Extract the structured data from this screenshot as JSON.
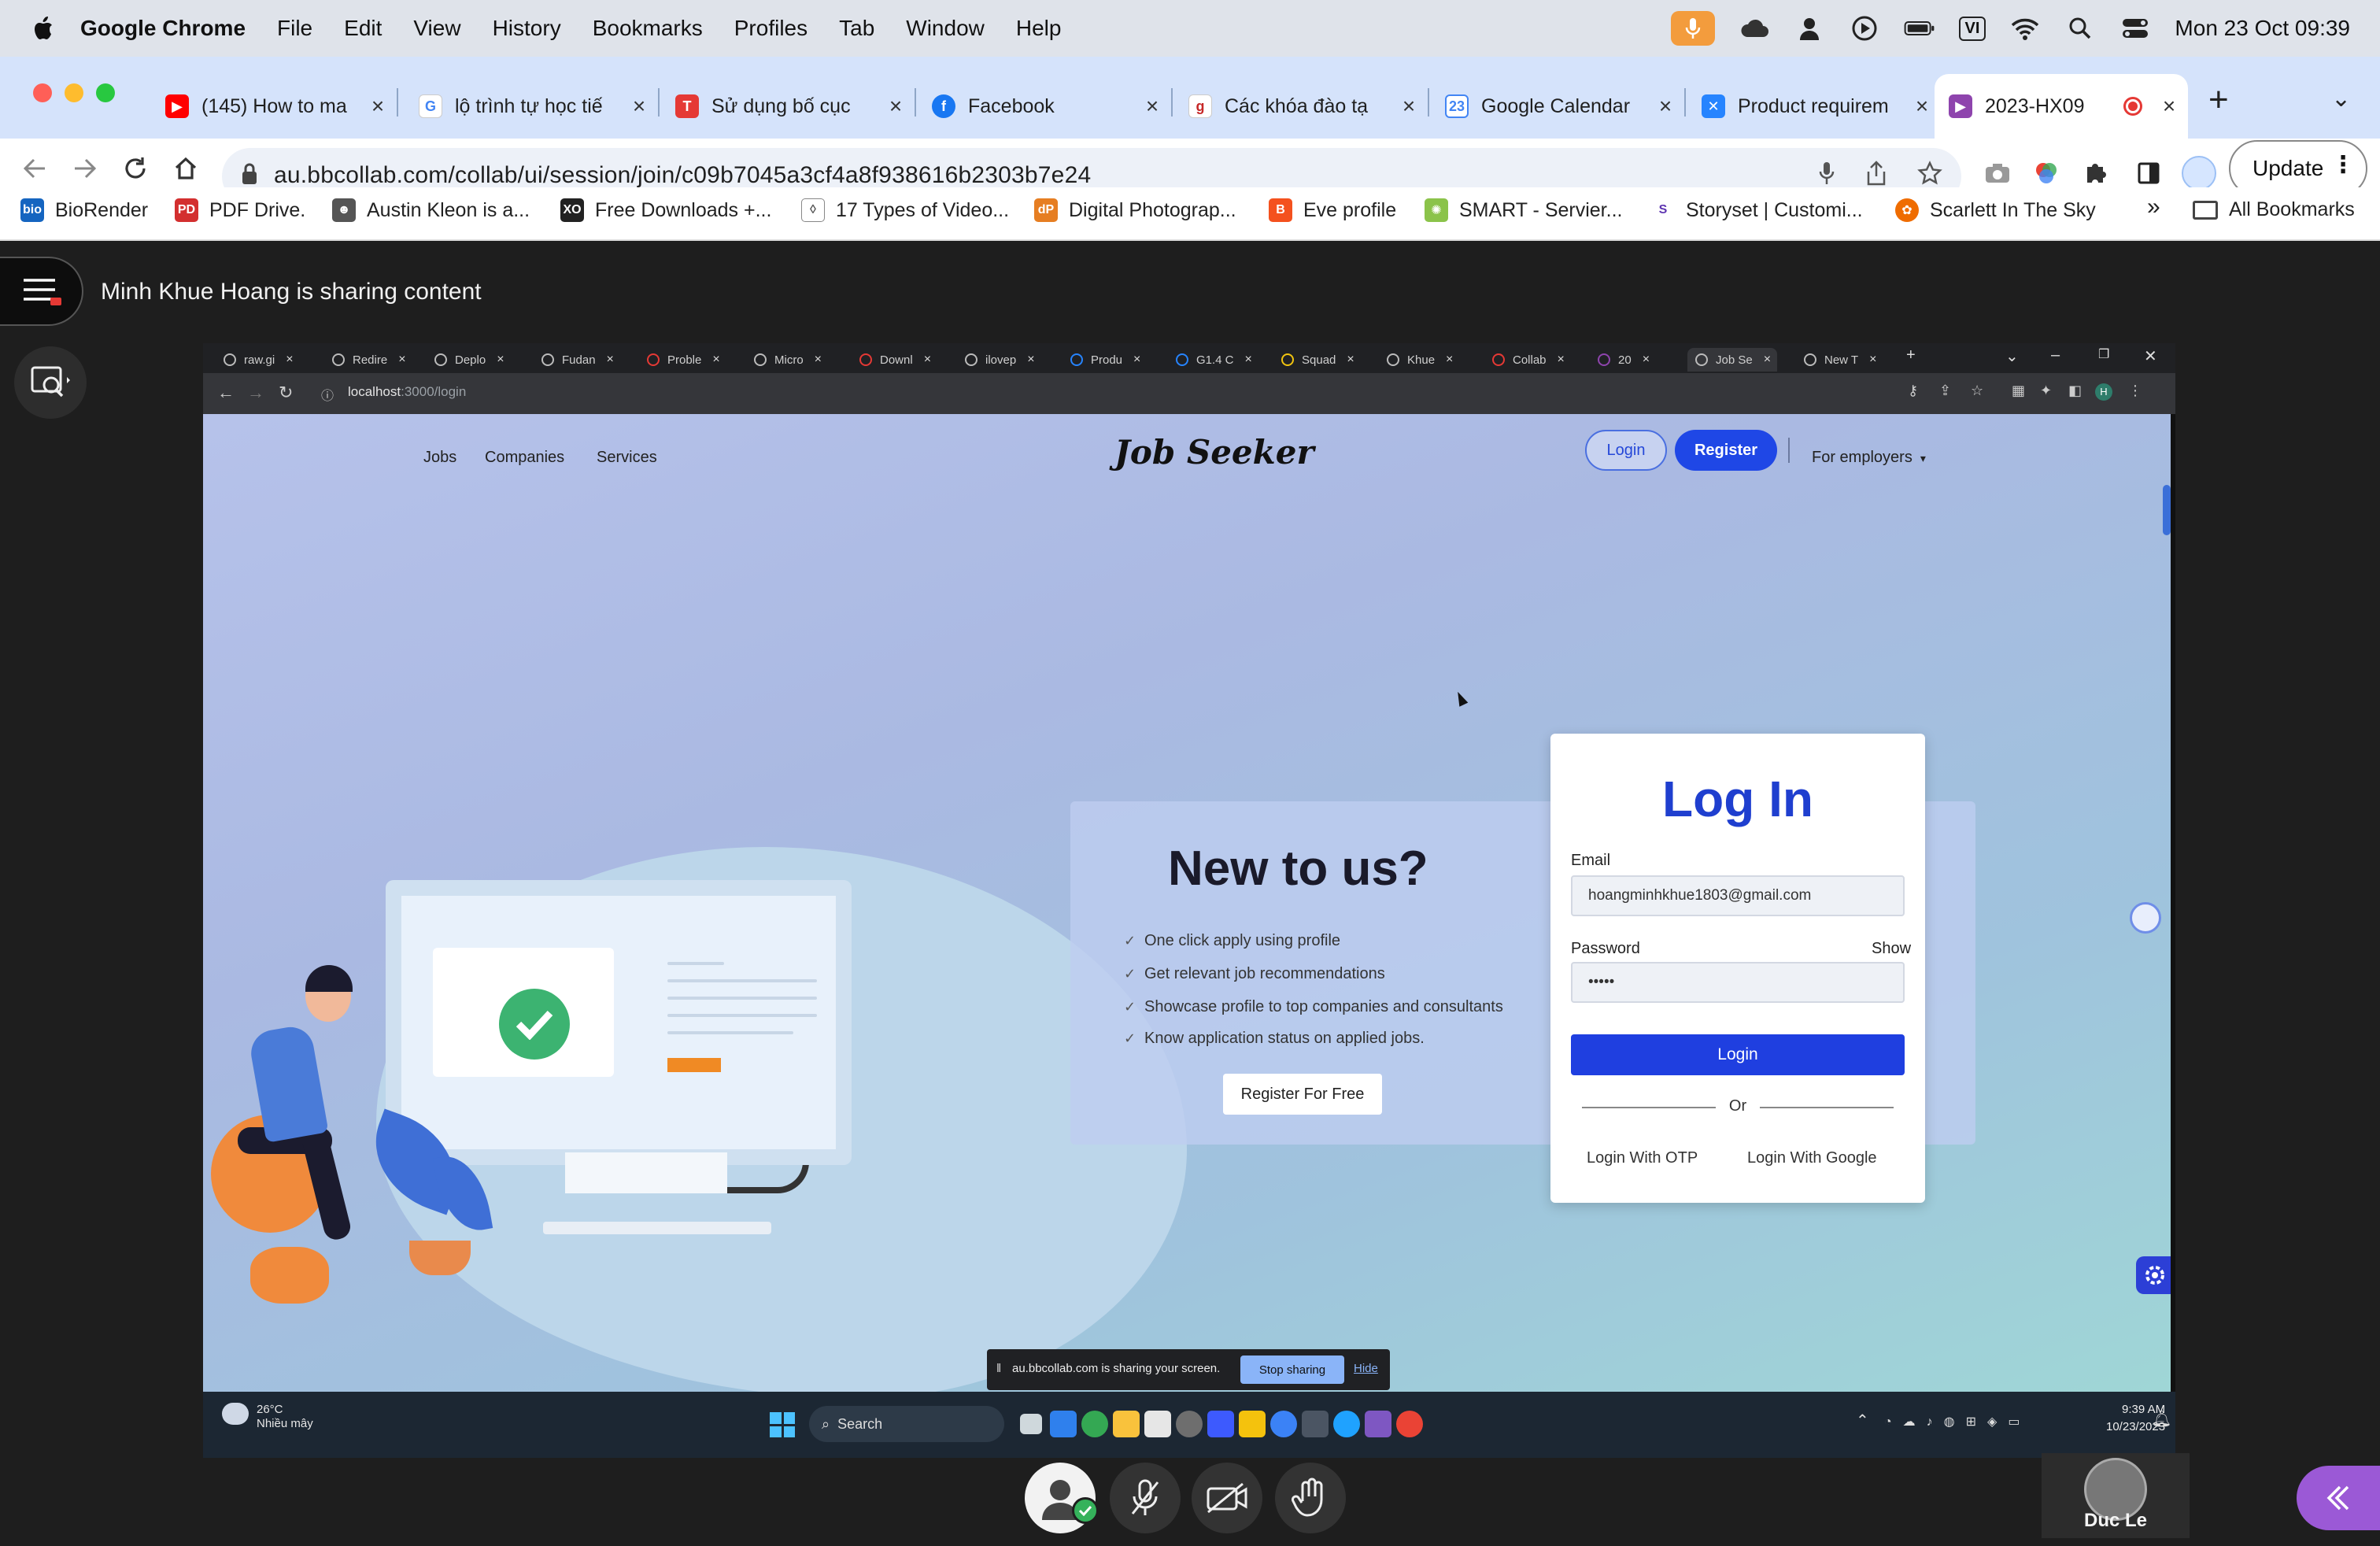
{
  "menubar": {
    "app_name": "Google Chrome",
    "items": [
      "File",
      "Edit",
      "View",
      "History",
      "Bookmarks",
      "Profiles",
      "Tab",
      "Window",
      "Help"
    ],
    "input_source": "VI",
    "datetime": "Mon 23 Oct  09:39"
  },
  "tabs": [
    {
      "label": "(145) How to ma",
      "icon": "youtube-icon",
      "color": "#ff0000"
    },
    {
      "label": "lộ trình tự học tiế",
      "icon": "google-icon",
      "color": "#4285f4"
    },
    {
      "label": "Sử dụng bố cục",
      "icon": "t-icon",
      "color": "#e53935"
    },
    {
      "label": "Facebook",
      "icon": "facebook-icon",
      "color": "#1877f2"
    },
    {
      "label": "Các khóa đào tạ",
      "icon": "course-icon",
      "color": "#c62828"
    },
    {
      "label": "Google Calendar",
      "icon": "calendar-icon",
      "color": "#4285f4"
    },
    {
      "label": "Product requirem",
      "icon": "jira-icon",
      "color": "#2684ff"
    },
    {
      "label": "2023-HX09",
      "icon": "bbcollab-icon",
      "color": "#8e44ad",
      "active": true
    }
  ],
  "address_bar": {
    "host": "au.bbcollab.com",
    "path": "/collab/ui/session/join/c09b7045a3cf4a8f938616b2303b7e24"
  },
  "toolbar": {
    "update_label": "Update"
  },
  "bookmarks": [
    {
      "label": "BioRender",
      "color": "#1565c0"
    },
    {
      "label": "PDF Drive.",
      "color": "#d32f2f"
    },
    {
      "label": "Austin Kleon is a...",
      "color": "#555555"
    },
    {
      "label": "Free Downloads +...",
      "color": "#222222"
    },
    {
      "label": "17 Types of Video...",
      "color": "#666666"
    },
    {
      "label": "Digital Photograp...",
      "color": "#e67e22"
    },
    {
      "label": "Eve profile",
      "color": "#f4511e"
    },
    {
      "label": "SMART - Servier...",
      "color": "#8bc34a"
    },
    {
      "label": "Storyset | Customi...",
      "color": "#5e35b1"
    },
    {
      "label": "Scarlett In The Sky",
      "color": "#ef6c00"
    }
  ],
  "bookmarks_more": "»",
  "bookmarks_all": "All Bookmarks",
  "session": {
    "sharing_text": "Minh Khue Hoang is sharing content"
  },
  "shared_screen": {
    "tabs": [
      "raw.gi",
      "Redire",
      "Deplo",
      "Fudan",
      "Proble",
      "Micro",
      "Downl",
      "ilovep",
      "Produ",
      "G1.4 C",
      "Squad",
      "Khue",
      "Collab",
      "20",
      "Job Se",
      "New T"
    ],
    "url_host": "localhost",
    "url_path": ":3000/login",
    "site": {
      "nav": [
        "Jobs",
        "Companies",
        "Services"
      ],
      "logo": "Job Seeker",
      "login": "Login",
      "register": "Register",
      "employers": "For employers",
      "promo_title": "New to us?",
      "promo_items": [
        "One click apply using profile",
        "Get relevant job recommendations",
        "Showcase profile to top companies and consultants",
        "Know application status on applied jobs."
      ],
      "promo_button": "Register For Free",
      "login_card": {
        "title": "Log In",
        "email_label": "Email",
        "email_value": "hoangminhkhue1803@gmail.com",
        "password_label": "Password",
        "show_label": "Show",
        "password_value": "•••••",
        "submit": "Login",
        "or": "Or",
        "otp": "Login With OTP",
        "google": "Login With Google"
      }
    },
    "share_bar": {
      "text": "au.bbcollab.com is sharing your screen.",
      "stop": "Stop sharing",
      "hide": "Hide"
    },
    "taskbar": {
      "temp": "26°C",
      "weather": "Nhiều mây",
      "search": "Search",
      "time": "9:39 AM",
      "date": "10/23/2023"
    }
  },
  "participant": {
    "name": "Duc Le"
  }
}
